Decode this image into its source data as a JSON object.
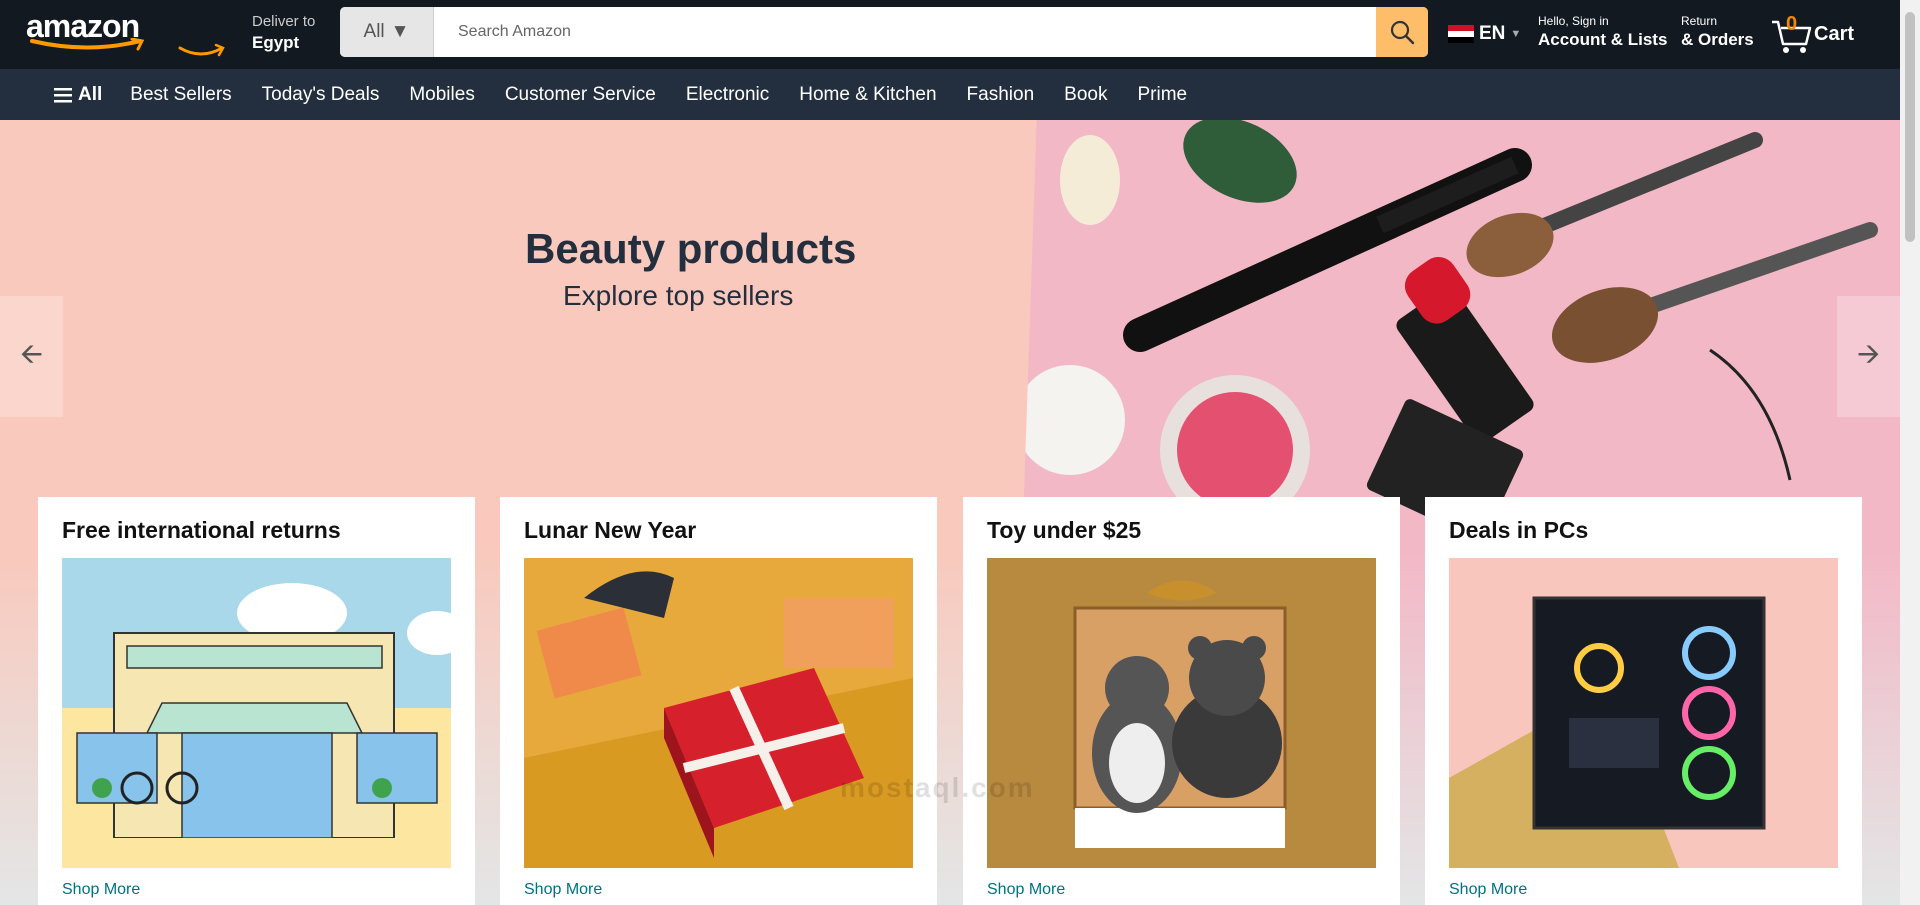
{
  "header": {
    "logo": "amazon",
    "deliver_label": "Deliver to",
    "deliver_location": "Egypt",
    "search_category": "All",
    "search_placeholder": "Search Amazon",
    "language": "EN",
    "account_line1": "Hello, Sign in",
    "account_line2": "Account & Lists",
    "orders_line1": "Return",
    "orders_line2": "& Orders",
    "cart_count": "0",
    "cart_label": "Cart"
  },
  "subnav": {
    "all_label": "All",
    "items": [
      "Best Sellers",
      "Today's Deals",
      "Mobiles",
      "Customer Service",
      "Electronic",
      "Home & Kitchen",
      "Fashion",
      "Book",
      "Prime"
    ]
  },
  "hero": {
    "title": "Beauty products",
    "subtitle": "Explore top sellers"
  },
  "cards": [
    {
      "title": "Free international returns",
      "link": "Shop More"
    },
    {
      "title": "Lunar New Year",
      "link": "Shop More"
    },
    {
      "title": "Toy under $25",
      "link": "Shop More"
    },
    {
      "title": "Deals in PCs",
      "link": "Shop More"
    }
  ],
  "watermark": "mostaql.com",
  "colors": {
    "header_bg": "#131921",
    "subnav_bg": "#232f3e",
    "search_button": "#febd69",
    "cart_count": "#f08804",
    "link": "#007185",
    "hero_bg": "#f9c9bd"
  }
}
